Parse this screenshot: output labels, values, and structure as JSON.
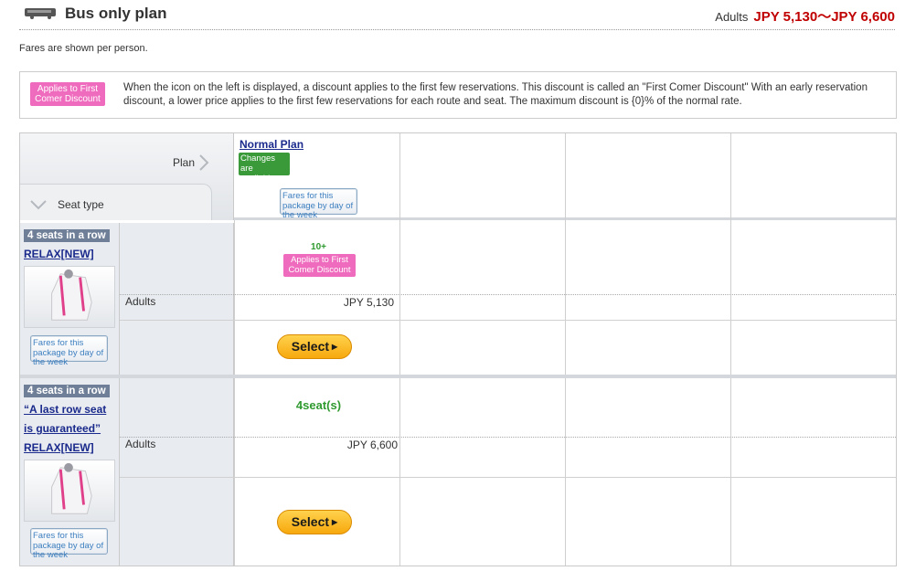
{
  "header": {
    "title": "Bus only plan",
    "adults_label": "Adults",
    "price_range": "JPY 5,130～JPY 6,600"
  },
  "note": "Fares are shown per person.",
  "discount_info": {
    "badge": "Applies to First Comer Discount",
    "text": "When the icon on the left is displayed, a discount applies to the first few reservations. This discount is called an \"First Comer Discount\" With an early reservation discount, a lower price applies to the first few reservations for each route and seat. The maximum discount is {0}% of the normal rate."
  },
  "table": {
    "plan_label": "Plan",
    "seat_type_label": "Seat type",
    "plan": {
      "name": "Normal Plan",
      "badge": "Changes are available",
      "fares_button": "Fares for this package by day of the week"
    },
    "rows": [
      {
        "tag": "4 seats in a row",
        "links": [
          "RELAX[NEW]"
        ],
        "fares_button": "Fares for this package by day of the week",
        "adults_label": "Adults",
        "availability": "10+",
        "first_comer_badge": "Applies to First Comer Discount",
        "price": "JPY 5,130",
        "select_label": "Select"
      },
      {
        "tag": "4 seats in a row",
        "links": [
          "“A last row seat",
          "is guaranteed”",
          "RELAX[NEW]"
        ],
        "fares_button": "Fares for this package by day of the week",
        "adults_label": "Adults",
        "availability": "4seat(s)",
        "price": "JPY 6,600",
        "select_label": "Select"
      }
    ]
  },
  "colors": {
    "price_red": "#c00000",
    "discount_pink": "#ef6bbd",
    "plan_green": "#3a9a3a",
    "select_orange": "#f7a80d",
    "link_blue": "#1a2a8c"
  }
}
